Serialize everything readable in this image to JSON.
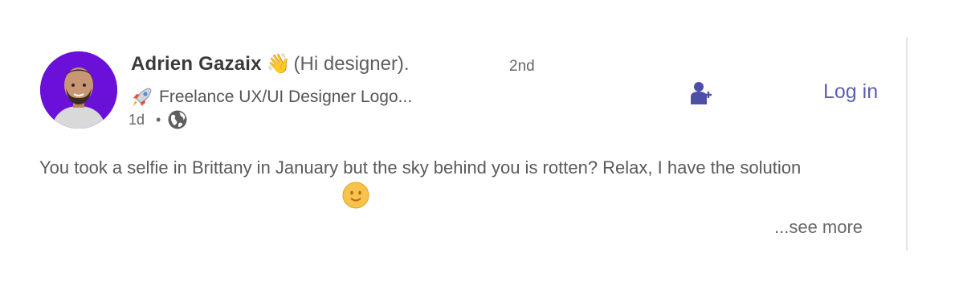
{
  "author": {
    "name": "Adrien Gazaix",
    "wave_emoji": "👋",
    "greeting": "(Hi designer).",
    "degree": "2nd",
    "headline_icon": "rocket-icon",
    "headline": "Freelance UX/UI Designer Logo...",
    "time": "1d",
    "separator": "•",
    "visibility_icon": "globe-icon"
  },
  "actions": {
    "follow_icon": "add-person-icon",
    "login_label": "Log in"
  },
  "post": {
    "text": "You took a selfie in Brittany in January but the sky behind you is rotten? Relax, I have the solution",
    "emoji_icon": "smiley-icon",
    "see_more_label": "...see more"
  },
  "colors": {
    "avatar_bg": "#6a10d8",
    "login_color": "#5b5fae",
    "follow_icon_color": "#4b4fa8"
  }
}
